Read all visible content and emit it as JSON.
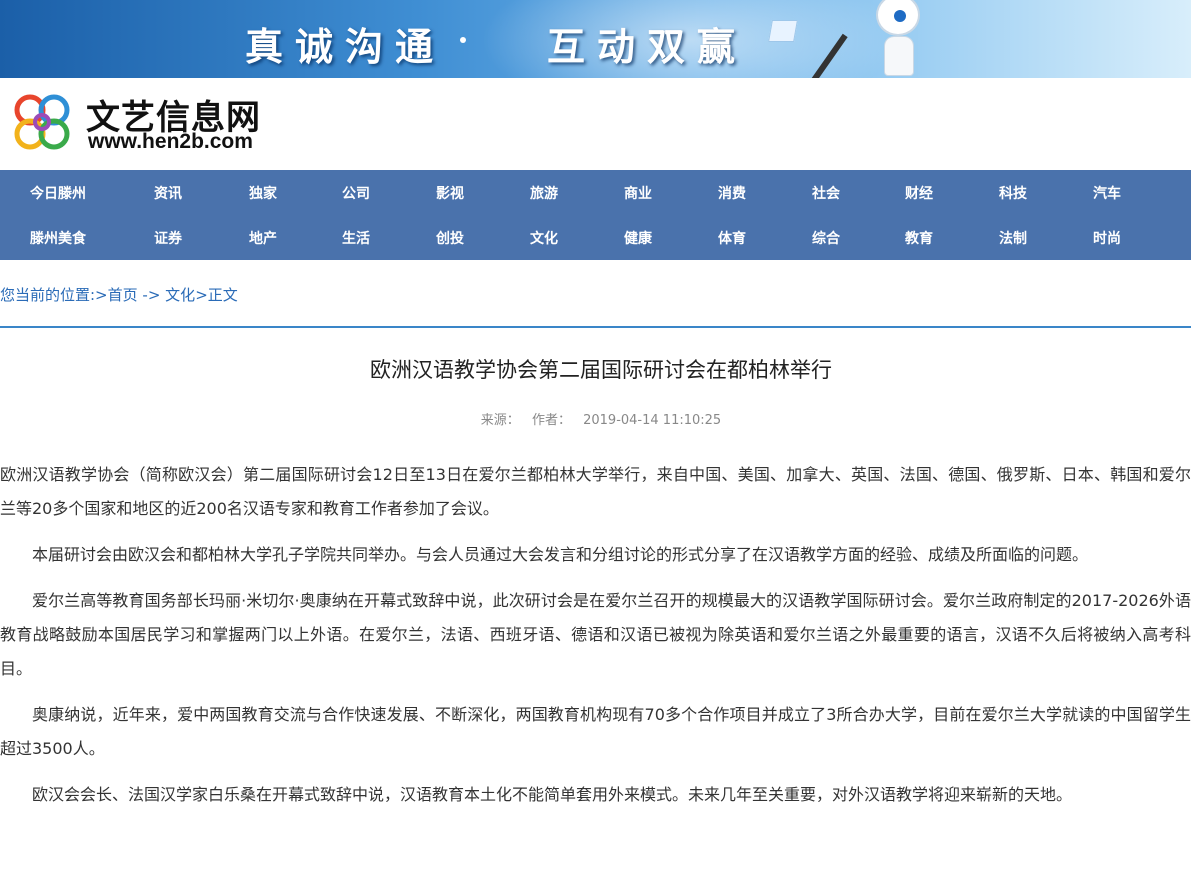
{
  "banner": {
    "slogan_left": "真诚沟通",
    "slogan_right": "互动双赢"
  },
  "logo": {
    "name": "文艺信息网",
    "url": "www.hen2b.com"
  },
  "nav": {
    "row1": [
      "今日滕州",
      "资讯",
      "独家",
      "公司",
      "影视",
      "旅游",
      "商业",
      "消费",
      "社会",
      "财经",
      "科技",
      "汽车"
    ],
    "row2": [
      "滕州美食",
      "证券",
      "地产",
      "生活",
      "创投",
      "文化",
      "健康",
      "体育",
      "综合",
      "教育",
      "法制",
      "时尚"
    ]
  },
  "breadcrumb": {
    "prefix": "您当前的位置:>",
    "home": "首页",
    "sep": " -> ",
    "category": "文化",
    "tail": ">正文"
  },
  "article": {
    "title": "欧洲汉语教学协会第二届国际研讨会在都柏林举行",
    "source_label": "来源：",
    "author_label": "作者：",
    "datetime": "2019-04-14 11:10:25",
    "paragraphs": [
      "欧洲汉语教学协会（简称欧汉会）第二届国际研讨会12日至13日在爱尔兰都柏林大学举行，来自中国、美国、加拿大、英国、法国、德国、俄罗斯、日本、韩国和爱尔兰等20多个国家和地区的近200名汉语专家和教育工作者参加了会议。",
      "本届研讨会由欧汉会和都柏林大学孔子学院共同举办。与会人员通过大会发言和分组讨论的形式分享了在汉语教学方面的经验、成绩及所面临的问题。",
      "爱尔兰高等教育国务部长玛丽·米切尔·奥康纳在开幕式致辞中说，此次研讨会是在爱尔兰召开的规模最大的汉语教学国际研讨会。爱尔兰政府制定的2017-2026外语教育战略鼓励本国居民学习和掌握两门以上外语。在爱尔兰，法语、西班牙语、德语和汉语已被视为除英语和爱尔兰语之外最重要的语言，汉语不久后将被纳入高考科目。",
      "奥康纳说，近年来，爱中两国教育交流与合作快速发展、不断深化，两国教育机构现有70多个合作项目并成立了3所合办大学，目前在爱尔兰大学就读的中国留学生超过3500人。",
      "欧汉会会长、法国汉学家白乐桑在开幕式致辞中说，汉语教育本土化不能简单套用外来模式。未来几年至关重要，对外汉语教学将迎来崭新的天地。"
    ]
  }
}
